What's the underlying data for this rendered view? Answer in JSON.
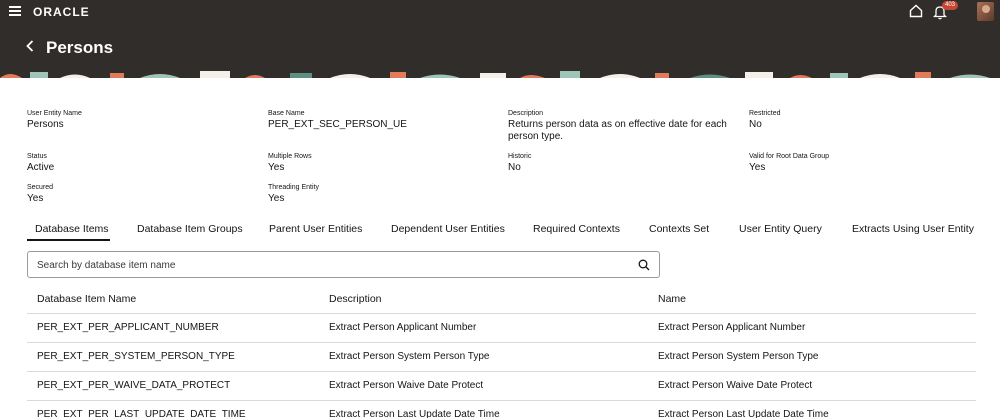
{
  "header": {
    "logo": "ORACLE",
    "notification_count": "403",
    "page_title": "Persons"
  },
  "details": [
    {
      "label": "User Entity Name",
      "value": "Persons"
    },
    {
      "label": "Base Name",
      "value": "PER_EXT_SEC_PERSON_UE"
    },
    {
      "label": "Description",
      "value": "Returns person data as on effective date for each person type."
    },
    {
      "label": "Restricted",
      "value": "No"
    },
    {
      "label": "Status",
      "value": "Active"
    },
    {
      "label": "Multiple Rows",
      "value": "Yes"
    },
    {
      "label": "Historic",
      "value": "No"
    },
    {
      "label": "Valid for Root Data Group",
      "value": "Yes"
    },
    {
      "label": "Secured",
      "value": "Yes"
    },
    {
      "label": "Threading Entity",
      "value": "Yes"
    }
  ],
  "tabs": [
    "Database Items",
    "Database Item Groups",
    "Parent User Entities",
    "Dependent User Entities",
    "Required Contexts",
    "Contexts Set",
    "User Entity Query",
    "Extracts Using User Entity"
  ],
  "search": {
    "placeholder": "Search by database item name",
    "value": ""
  },
  "table": {
    "columns": [
      "Database Item Name",
      "Description",
      "Name"
    ],
    "rows": [
      [
        "PER_EXT_PER_APPLICANT_NUMBER",
        "Extract Person Applicant Number",
        "Extract Person Applicant Number"
      ],
      [
        "PER_EXT_PER_SYSTEM_PERSON_TYPE",
        "Extract Person System Person Type",
        "Extract Person System Person Type"
      ],
      [
        "PER_EXT_PER_WAIVE_DATA_PROTECT",
        "Extract Person Waive Date Protect",
        "Extract Person Waive Date Protect"
      ],
      [
        "PER_EXT_PER_LAST_UPDATE_DATE_TIME",
        "Extract Person Last Update Date Time",
        "Extract Person Last Update Date Time"
      ]
    ]
  },
  "colors": {
    "header_bg": "#312d2a",
    "badge": "#c74634",
    "text": "#161513",
    "border": "#dcd9d5"
  }
}
